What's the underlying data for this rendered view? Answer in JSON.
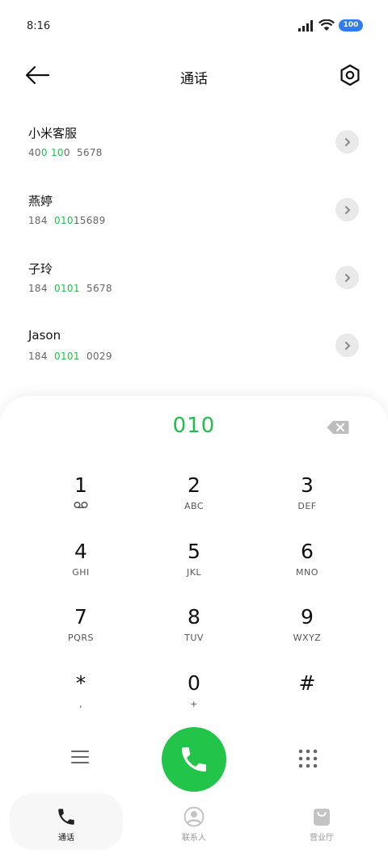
{
  "status": {
    "time": "8:16",
    "battery": "100"
  },
  "header": {
    "title": "通话"
  },
  "contacts": [
    {
      "name": "小米客服",
      "number_parts": [
        "40",
        "0",
        " ",
        "10",
        "0  5678"
      ]
    },
    {
      "name": "燕婷",
      "number_parts": [
        "184  ",
        "010",
        "15689"
      ]
    },
    {
      "name": "子玲",
      "number_parts": [
        "184  ",
        "0101",
        "  5678"
      ]
    },
    {
      "name": "Jason",
      "number_parts": [
        "184  ",
        "0101",
        "  0029"
      ]
    }
  ],
  "dialer": {
    "input": "010"
  },
  "keys": [
    {
      "digit": "1",
      "letters": ""
    },
    {
      "digit": "2",
      "letters": "ABC"
    },
    {
      "digit": "3",
      "letters": "DEF"
    },
    {
      "digit": "4",
      "letters": "GHI"
    },
    {
      "digit": "5",
      "letters": "JKL"
    },
    {
      "digit": "6",
      "letters": "MNO"
    },
    {
      "digit": "7",
      "letters": "PQRS"
    },
    {
      "digit": "8",
      "letters": "TUV"
    },
    {
      "digit": "9",
      "letters": "WXYZ"
    },
    {
      "digit": "*",
      "letters": ","
    },
    {
      "digit": "0",
      "letters": "+"
    },
    {
      "digit": "#",
      "letters": ""
    }
  ],
  "tabs": [
    {
      "label": "通话",
      "icon": "phone-icon",
      "active": true
    },
    {
      "label": "联系人",
      "icon": "person-icon",
      "active": false
    },
    {
      "label": "营业厅",
      "icon": "bag-icon",
      "active": false
    }
  ],
  "colors": {
    "accent": "#22c54a",
    "highlight": "#1fbf4a",
    "battery": "#2f7cf6"
  }
}
